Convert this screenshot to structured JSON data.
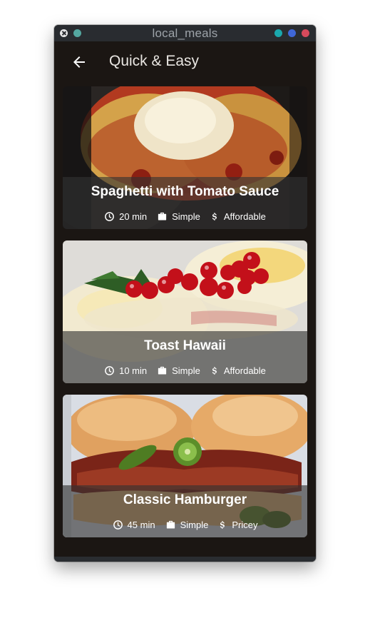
{
  "window": {
    "title": "local_meals",
    "controls": [
      {
        "name": "close",
        "color": "#e7e7e7"
      },
      {
        "name": "minimize-left",
        "color": "#54a7a0"
      },
      {
        "name": "teal",
        "color": "#1aa8ad"
      },
      {
        "name": "blue",
        "color": "#3f67d8"
      },
      {
        "name": "red",
        "color": "#d64a5c"
      }
    ]
  },
  "appbar": {
    "back_icon": "arrow-left-icon",
    "title": "Quick & Easy"
  },
  "meals": [
    {
      "title": "Spaghetti with Tomato Sauce",
      "duration": "20 min",
      "complexity": "Simple",
      "affordability": "Affordable"
    },
    {
      "title": "Toast Hawaii",
      "duration": "10 min",
      "complexity": "Simple",
      "affordability": "Affordable"
    },
    {
      "title": "Classic Hamburger",
      "duration": "45 min",
      "complexity": "Simple",
      "affordability": "Pricey"
    }
  ],
  "icons": {
    "duration": "clock-icon",
    "complexity": "briefcase-icon",
    "affordability": "dollar-icon"
  }
}
